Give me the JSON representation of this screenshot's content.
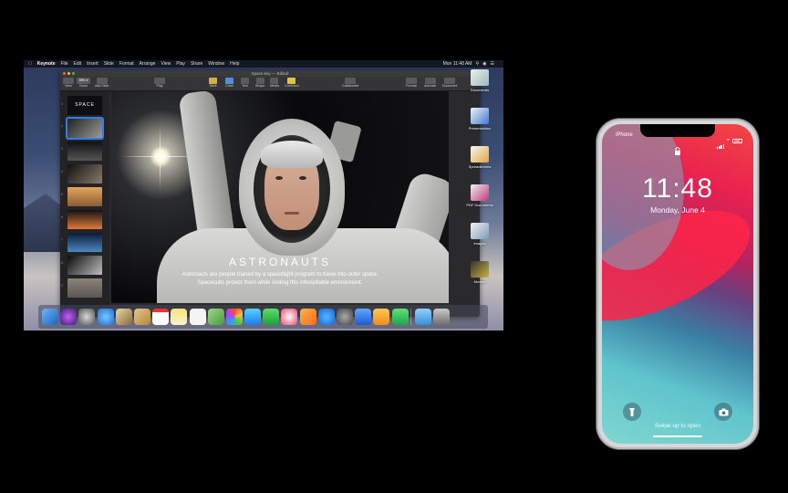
{
  "mac": {
    "menubar": {
      "app_name": "Keynote",
      "items": [
        "File",
        "Edit",
        "Insert",
        "Slide",
        "Format",
        "Arrange",
        "View",
        "Play",
        "Share",
        "Window",
        "Help"
      ],
      "clock": "Mon 11:48 AM"
    },
    "keynote": {
      "window_title": "Space.key — Edited",
      "toolbar": {
        "view": "View",
        "zoom_value": "99% ▾",
        "zoom": "Zoom",
        "add_slide": "Add Slide",
        "play": "Play",
        "table": "Table",
        "chart": "Chart",
        "text": "Text",
        "shape": "Shape",
        "media": "Media",
        "comment": "Comment",
        "collaborate": "Collaborate",
        "format": "Format",
        "animate": "Animate",
        "document": "Document"
      },
      "navigator": {
        "first_slide_label": "SPACE",
        "slide_numbers": [
          "1",
          "2",
          "3",
          "4",
          "5",
          "6",
          "7",
          "8",
          "9"
        ]
      },
      "slide": {
        "title": "ASTRONAUTS",
        "body_line1": "Astronauts are people trained by a spaceflight program to travel into outer space.",
        "body_line2": "Spacesuits protect them while visiting this inhospitable environment."
      }
    },
    "desktop_icons": [
      "Documents",
      "Presentations",
      "Spreadsheets",
      "PDF Documents",
      "Images",
      "Movies"
    ]
  },
  "iphone": {
    "carrier": "iPhone",
    "time": "11:48",
    "date": "Monday, June 4",
    "swipe_hint": "Swipe up to open"
  }
}
